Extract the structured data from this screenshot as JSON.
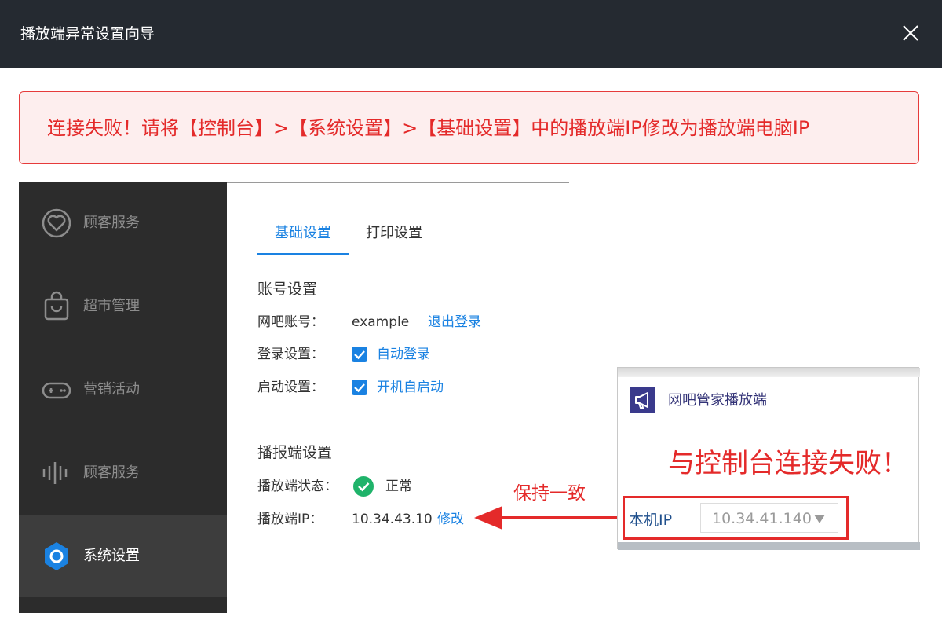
{
  "dialog": {
    "title": "播放端异常设置向导",
    "close_icon": "close-icon"
  },
  "alert": {
    "message": "连接失败！请将【控制台】>【系统设置】>【基础设置】中的播放端IP修改为播放端电脑IP",
    "colors": {
      "text": "#e42a2a",
      "background": "#fdeeee",
      "border": "#e63b3b"
    }
  },
  "sidebar": {
    "items": [
      {
        "label": "顾客服务",
        "icon": "heart-icon",
        "active": false
      },
      {
        "label": "超市管理",
        "icon": "shopping-bag-icon",
        "active": false
      },
      {
        "label": "营销活动",
        "icon": "gamepad-icon",
        "active": false
      },
      {
        "label": "顾客服务",
        "icon": "audio-wave-icon",
        "active": false
      },
      {
        "label": "系统设置",
        "icon": "settings-gear-icon",
        "active": true
      }
    ]
  },
  "tabs": [
    {
      "label": "基础设置",
      "active": true
    },
    {
      "label": "打印设置",
      "active": false
    }
  ],
  "account": {
    "section_title": "账号设置",
    "account_label": "网吧账号：",
    "account_value": "example",
    "logout_link": "退出登录",
    "login_label": "登录设置：",
    "auto_login": "自动登录",
    "auto_login_checked": true,
    "startup_label": "启动设置：",
    "auto_start": "开机自启动",
    "auto_start_checked": true
  },
  "player": {
    "section_title": "播报端设置",
    "status_label": "播放端状态：",
    "status_value": "正常",
    "ip_label": "播放端IP：",
    "ip_value": "10.34.43.10",
    "edit_link": "修改"
  },
  "annotation": {
    "keep_text": "保持一致"
  },
  "popup": {
    "app_title": "网吧管家播放端",
    "fail_message": "与控制台连接失败！",
    "ip_label": "本机IP",
    "ip_value": "10.34.41.140"
  },
  "colors": {
    "accent": "#1a82e2",
    "sidebar_bg": "#2c2c2c",
    "error": "#e42a2a",
    "success": "#1fb36a"
  }
}
